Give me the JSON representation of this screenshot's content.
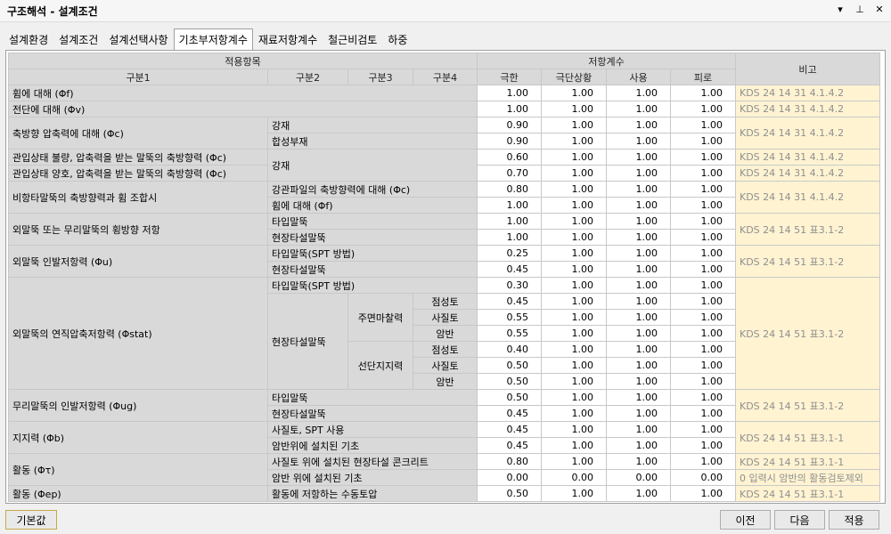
{
  "window": {
    "title": "구조해석 - 설계조건",
    "menu_icon": "▾",
    "pin_icon": "⊥",
    "close_icon": "✕"
  },
  "tabs": [
    "설계환경",
    "설계조건",
    "설계선택사항",
    "기초부저항계수",
    "재료저항계수",
    "철근비검토",
    "하중"
  ],
  "active_tab": 3,
  "table": {
    "header": {
      "applied": "적용항목",
      "resist": "저항계수",
      "note": "비고",
      "c1": "구분1",
      "c2": "구분2",
      "c3": "구분3",
      "c4": "구분4",
      "v1": "극한",
      "v2": "극단상황",
      "v3": "사용",
      "v4": "피로"
    },
    "labels": {
      "r0": "휨에 대해 (Φf)",
      "r1": "전단에 대해 (Φv)",
      "r2": "축방향 압축력에 대해 (Φc)",
      "r2a": "강재",
      "r2b": "합성부재",
      "r4": "관입상태 불량, 압축력을 받는 말뚝의 축방향력 (Φc)",
      "r45": "강재",
      "r5": "관입상태 양호, 압축력을 받는 말뚝의 축방향력 (Φc)",
      "r6": "비항타말뚝의 축방향력과 휨 조합시",
      "r6a": "강관파일의 축방향력에 대해 (Φc)",
      "r6b": "휨에 대해 (Φf)",
      "r8": "외말뚝 또는 무리말뚝의 횡방향 저항",
      "r8a": "타입말뚝",
      "r8b": "현장타설말뚝",
      "r10": "외말뚝 인발저항력 (Φu)",
      "r10a": "타입말뚝(SPT 방법)",
      "r10b": "현장타설말뚝",
      "r12": "외말뚝의 연직압축저항력 (Φstat)",
      "r12a": "타입말뚝(SPT 방법)",
      "r13": "현장타설말뚝",
      "side": "주면마찰력",
      "tip": "선단지지력",
      "s1": "점성토",
      "s2": "사질토",
      "s3": "암반",
      "t1": "점성토",
      "t2": "사질토",
      "t3": "암반",
      "r19": "무리말뚝의 인발저항력 (Φug)",
      "r19a": "타입말뚝",
      "r19b": "현장타설말뚝",
      "r21": "지지력 (Φb)",
      "r21a": "사질토, SPT 사용",
      "r21b": "암반위에 설치된 기초",
      "r23": "활동 (Φτ)",
      "r23a": "사질토 위에 설치된 현장타설 콘크리트",
      "r23b": "암반 위에 설치된 기초",
      "r25": "활동 (Φep)",
      "r25a": "활동에 저항하는 수동토압"
    },
    "values": [
      [
        "1.00",
        "1.00",
        "1.00",
        "1.00"
      ],
      [
        "1.00",
        "1.00",
        "1.00",
        "1.00"
      ],
      [
        "0.90",
        "1.00",
        "1.00",
        "1.00"
      ],
      [
        "0.90",
        "1.00",
        "1.00",
        "1.00"
      ],
      [
        "0.60",
        "1.00",
        "1.00",
        "1.00"
      ],
      [
        "0.70",
        "1.00",
        "1.00",
        "1.00"
      ],
      [
        "0.80",
        "1.00",
        "1.00",
        "1.00"
      ],
      [
        "1.00",
        "1.00",
        "1.00",
        "1.00"
      ],
      [
        "1.00",
        "1.00",
        "1.00",
        "1.00"
      ],
      [
        "1.00",
        "1.00",
        "1.00",
        "1.00"
      ],
      [
        "0.25",
        "1.00",
        "1.00",
        "1.00"
      ],
      [
        "0.45",
        "1.00",
        "1.00",
        "1.00"
      ],
      [
        "0.30",
        "1.00",
        "1.00",
        "1.00"
      ],
      [
        "0.45",
        "1.00",
        "1.00",
        "1.00"
      ],
      [
        "0.55",
        "1.00",
        "1.00",
        "1.00"
      ],
      [
        "0.55",
        "1.00",
        "1.00",
        "1.00"
      ],
      [
        "0.40",
        "1.00",
        "1.00",
        "1.00"
      ],
      [
        "0.50",
        "1.00",
        "1.00",
        "1.00"
      ],
      [
        "0.50",
        "1.00",
        "1.00",
        "1.00"
      ],
      [
        "0.50",
        "1.00",
        "1.00",
        "1.00"
      ],
      [
        "0.45",
        "1.00",
        "1.00",
        "1.00"
      ],
      [
        "0.45",
        "1.00",
        "1.00",
        "1.00"
      ],
      [
        "0.45",
        "1.00",
        "1.00",
        "1.00"
      ],
      [
        "0.80",
        "1.00",
        "1.00",
        "1.00"
      ],
      [
        "0.00",
        "0.00",
        "0.00",
        "0.00"
      ],
      [
        "0.50",
        "1.00",
        "1.00",
        "1.00"
      ]
    ],
    "notes": {
      "n0": "KDS 24 14 31 4.1.4.2",
      "n1": "KDS 24 14 31 4.1.4.2",
      "n2": "KDS 24 14 31 4.1.4.2",
      "n4": "KDS 24 14 31 4.1.4.2",
      "n5": "KDS 24 14 31 4.1.4.2",
      "n6": "KDS 24 14 31 4.1.4.2",
      "n8": "KDS 24 14 51 표3.1-2",
      "n10": "KDS 24 14 51 표3.1-2",
      "n12": "KDS 24 14 51 표3.1-2",
      "n19": "KDS 24 14 51 표3.1-2",
      "n21": "KDS 24 14 51 표3.1-1",
      "n23": "KDS 24 14 51 표3.1-1",
      "n24": "0 입력시 암반의 활동검토제외",
      "n25": "KDS 24 14 51 표3.1-1"
    }
  },
  "buttons": {
    "default": "기본값",
    "prev": "이전",
    "next": "다음",
    "apply": "적용"
  }
}
